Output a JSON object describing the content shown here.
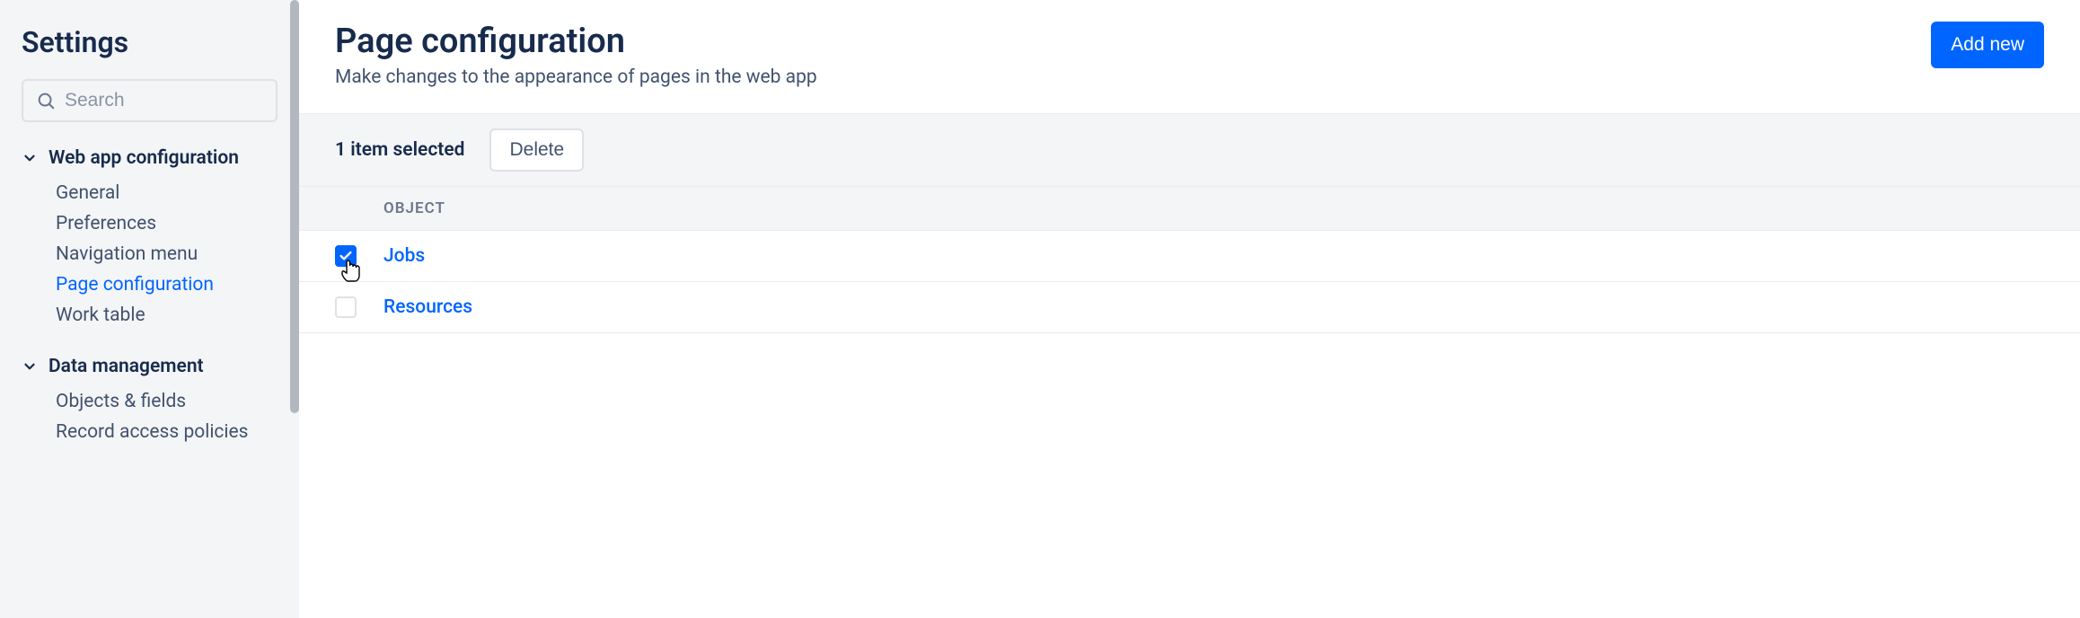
{
  "sidebar": {
    "title": "Settings",
    "search_placeholder": "Search",
    "sections": [
      {
        "title": "Web app configuration",
        "items": [
          "General",
          "Preferences",
          "Navigation menu",
          "Page configuration",
          "Work table"
        ],
        "active_index": 3
      },
      {
        "title": "Data management",
        "items": [
          "Objects & fields",
          "Record access policies"
        ]
      }
    ]
  },
  "main": {
    "title": "Page configuration",
    "subtitle": "Make changes to the appearance of pages in the web app",
    "add_button": "Add new",
    "selection_count_text": "1 item selected",
    "delete_button": "Delete",
    "columns": {
      "object": "OBJECT"
    },
    "rows": [
      {
        "label": "Jobs",
        "checked": true
      },
      {
        "label": "Resources",
        "checked": false
      }
    ]
  }
}
